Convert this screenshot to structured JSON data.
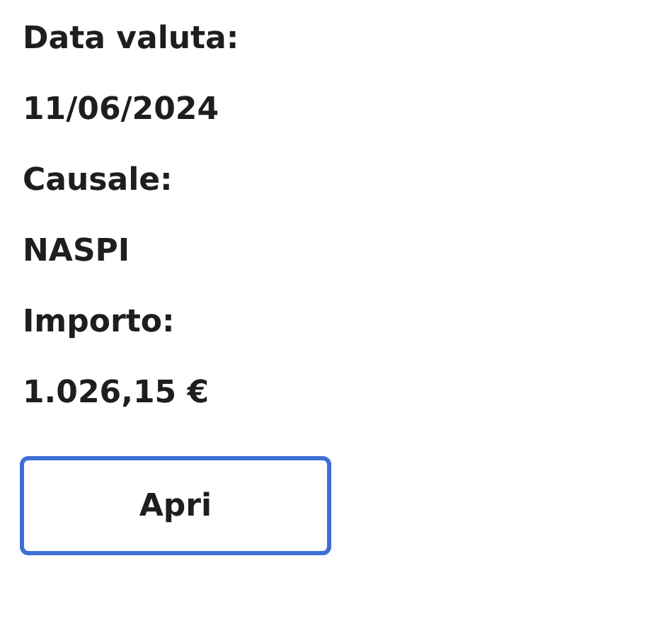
{
  "fields": [
    {
      "label": "Data valuta:",
      "value": "11/06/2024"
    },
    {
      "label": "Causale:",
      "value": "NASPI"
    },
    {
      "label": "Importo:",
      "value": "1.026,15 €"
    }
  ],
  "button": "Apri"
}
